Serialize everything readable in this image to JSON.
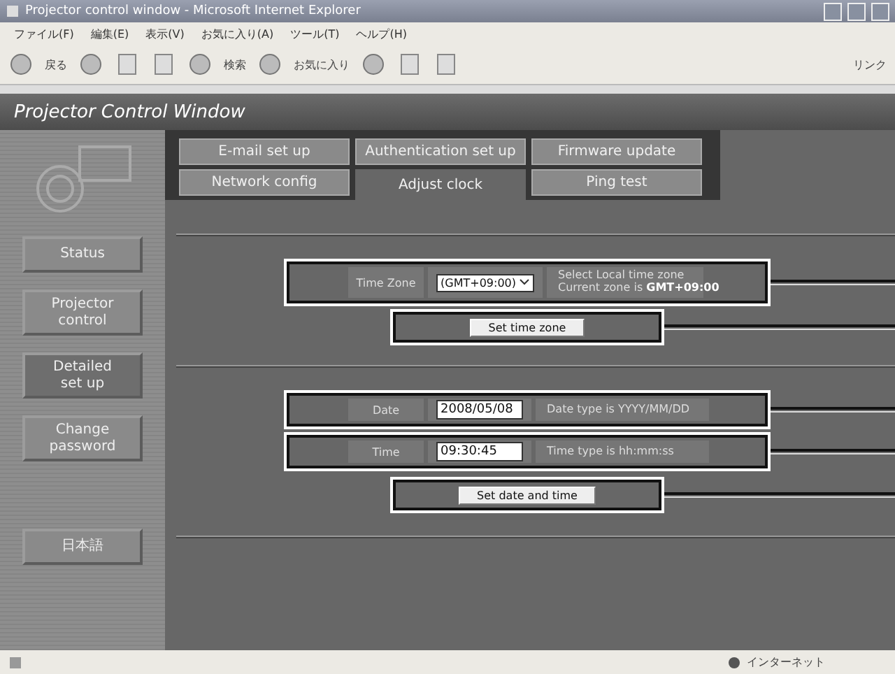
{
  "window": {
    "title": "Projector control window - Microsoft Internet Explorer"
  },
  "menu": [
    "ファイル(F)",
    "編集(E)",
    "表示(V)",
    "お気に入り(A)",
    "ツール(T)",
    "ヘルプ(H)"
  ],
  "toolbar": {
    "back_label": "戻る",
    "search_label": "検索",
    "favorites_label": "お気に入り",
    "links_label": "リンク"
  },
  "page_header": "Projector Control Window",
  "sidebar": [
    {
      "label": "Status",
      "selected": false
    },
    {
      "label": "Projector control",
      "selected": false
    },
    {
      "label": "Detailed set up",
      "selected": true
    },
    {
      "label": "Change password",
      "selected": false
    }
  ],
  "language_button": "日本語",
  "tabs": [
    [
      {
        "label": "E-mail set up",
        "selected": false
      },
      {
        "label": "Authentication set up",
        "selected": false
      },
      {
        "label": "Firmware update",
        "selected": false
      }
    ],
    [
      {
        "label": "Network config",
        "selected": false
      },
      {
        "label": "Adjust clock",
        "selected": true
      },
      {
        "label": "Ping test",
        "selected": false
      }
    ]
  ],
  "time_zone": {
    "label": "Time Zone",
    "value": "(GMT+09:00)",
    "hint": "Select Local time zone",
    "current": "Current zone is **GMT+09:00**"
  },
  "set_time_zone_button": "Set time zone",
  "date": {
    "label": "Date",
    "value": "2008/05/08",
    "hint": "Date type is YYYY/MM/DD"
  },
  "time": {
    "label": "Time",
    "value": "09:30:45",
    "hint": "Time type is hh:mm:ss"
  },
  "set_date_time_button": "Set date and time",
  "status_bar": {
    "zone": "インターネット"
  }
}
